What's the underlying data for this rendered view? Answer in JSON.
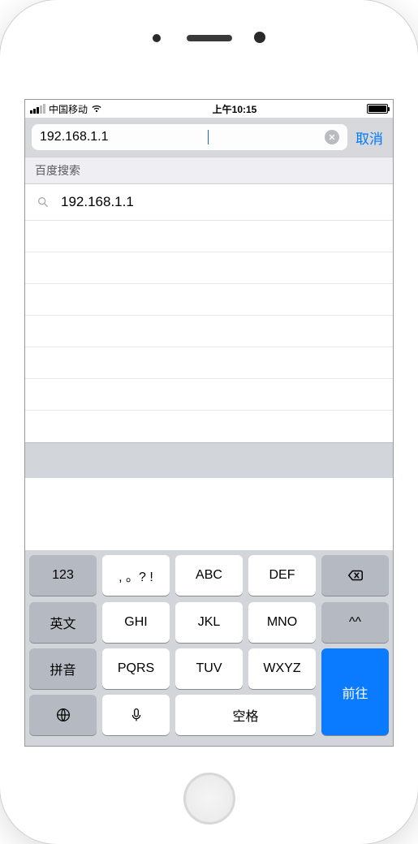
{
  "status": {
    "carrier": "中国移动",
    "time": "上午10:15"
  },
  "addressBar": {
    "value": "192.168.1.1",
    "cancel": "取消"
  },
  "suggestions": {
    "header": "百度搜索",
    "items": [
      {
        "label": "192.168.1.1"
      }
    ]
  },
  "keyboard": {
    "rows": [
      [
        "123",
        ", 。? !",
        "ABC",
        "DEF",
        "⌫"
      ],
      [
        "英文",
        "GHI",
        "JKL",
        "MNO",
        "^^"
      ],
      [
        "拼音",
        "PQRS",
        "TUV",
        "WXYZ"
      ]
    ],
    "go": "前往",
    "space": "空格"
  }
}
